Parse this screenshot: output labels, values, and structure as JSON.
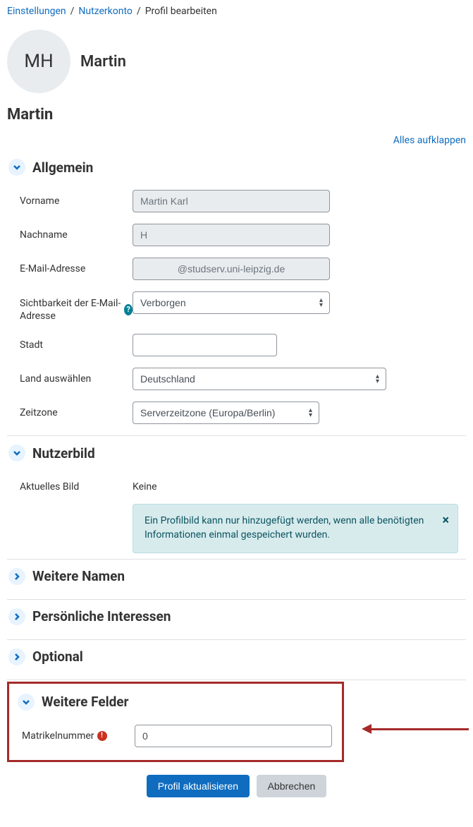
{
  "breadcrumb": {
    "item1": "Einstellungen",
    "item2": "Nutzerkonto",
    "item3": "Profil bearbeiten"
  },
  "profile": {
    "initials": "MH",
    "name": "Martin"
  },
  "page_title": "Martin",
  "expand_all": "Alles aufklappen",
  "sections": {
    "general": {
      "title": "Allgemein",
      "vorname_label": "Vorname",
      "vorname_value": "Martin Karl",
      "nachname_label": "Nachname",
      "nachname_value": "H",
      "email_label": "E-Mail-Adresse",
      "email_value": "@studserv.uni-leipzig.de",
      "visibility_label": "Sichtbarkeit der E-Mail-Adresse",
      "visibility_value": "Verborgen",
      "stadt_label": "Stadt",
      "stadt_value": "",
      "land_label": "Land auswählen",
      "land_value": "Deutschland",
      "zeitzone_label": "Zeitzone",
      "zeitzone_value": "Serverzeitzone (Europa/Berlin)"
    },
    "nutzerbild": {
      "title": "Nutzerbild",
      "aktuell_label": "Aktuelles Bild",
      "aktuell_value": "Keine",
      "info": "Ein Profilbild kann nur hinzugefügt werden, wenn alle benötigten Informationen einmal gespeichert wurden."
    },
    "weitere_namen": {
      "title": "Weitere Namen"
    },
    "interessen": {
      "title": "Persönliche Interessen"
    },
    "optional": {
      "title": "Optional"
    },
    "weitere_felder": {
      "title": "Weitere Felder",
      "matrikel_label": "Matrikelnummer",
      "matrikel_value": "0"
    }
  },
  "buttons": {
    "save": "Profil aktualisieren",
    "cancel": "Abbrechen"
  }
}
